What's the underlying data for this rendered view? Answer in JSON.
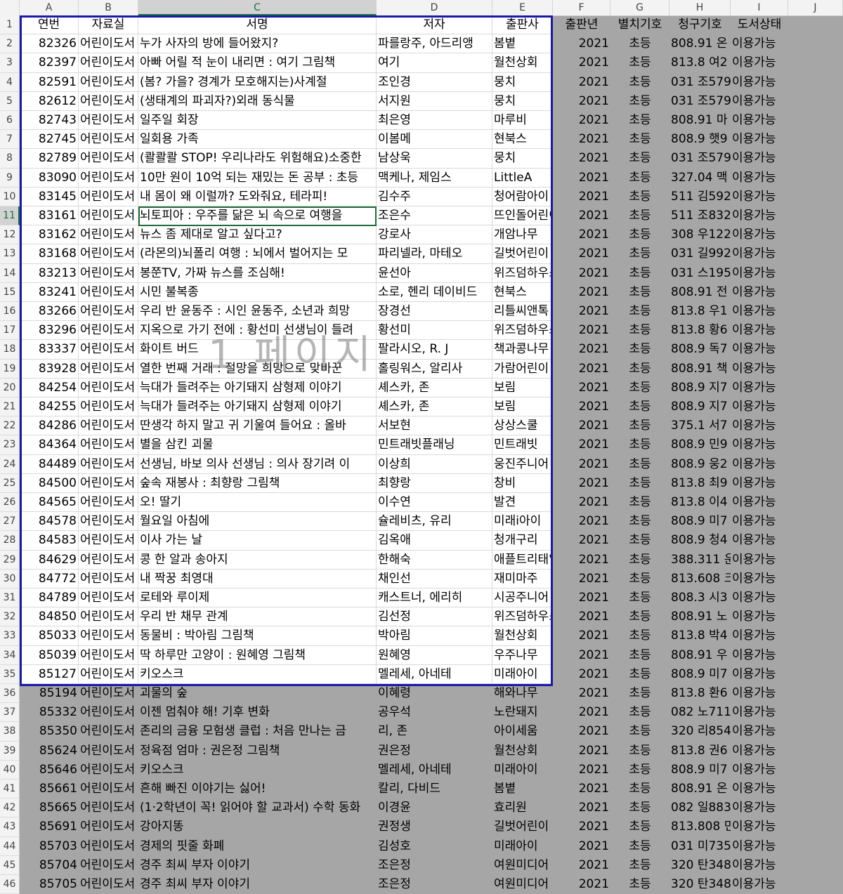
{
  "column_headers": [
    "A",
    "B",
    "C",
    "D",
    "E",
    "F",
    "G",
    "H",
    "I",
    "J"
  ],
  "selected_column": "C",
  "selected_row": 11,
  "watermark": "1 페이지",
  "header_row": [
    "연번",
    "자료실",
    "서명",
    "저자",
    "출판사",
    "출판년",
    "별치기호",
    "청구기호",
    "도서상태"
  ],
  "rows": [
    [
      "82326",
      "어린이도서",
      "누가 사자의 방에 들어왔지?",
      "파를랑주, 아드리앵",
      "봄볕",
      "2021",
      "초등",
      "808.91 온",
      "이용가능"
    ],
    [
      "82397",
      "어린이도서",
      "아빠 어릴 적 눈이 내리면 : 여기 그림책",
      "여기",
      "월천상회",
      "2021",
      "초등",
      "813.8 여2",
      "이용가능"
    ],
    [
      "82591",
      "어린이도서",
      "(봄? 가을? 경계가 모호해지는)사계절",
      "조인경",
      "뭉치",
      "2021",
      "초등",
      "031 조579",
      "이용가능"
    ],
    [
      "82612",
      "어린이도서",
      "(생태계의 파괴자?)외래 동식물",
      "서지원",
      "뭉치",
      "2021",
      "초등",
      "031 조579",
      "이용가능"
    ],
    [
      "82743",
      "어린이도서",
      "일주일 회장",
      "최은영",
      "마루비",
      "2021",
      "초등",
      "808.91 마",
      "이용가능"
    ],
    [
      "82745",
      "어린이도서",
      "일회용 가족",
      "이봄메",
      "현북스",
      "2021",
      "초등",
      "808.9 햇9",
      "이용가능"
    ],
    [
      "82789",
      "어린이도서",
      "(콸콸콸 STOP! 우리나라도 위험해요)소중한",
      "남상욱",
      "뭉치",
      "2021",
      "초등",
      "031 조579",
      "이용가능"
    ],
    [
      "83090",
      "어린이도서",
      "10만 원이 10억 되는 재밌는 돈 공부 : 초등",
      "맥케나, 제임스",
      "LittleA",
      "2021",
      "초등",
      "327.04 맥",
      "이용가능"
    ],
    [
      "83145",
      "어린이도서",
      "내 몸이 왜 이럴까? 도와줘요, 테라피!",
      "김수주",
      "청어람아이",
      "2021",
      "초등",
      "511 김592",
      "이용가능"
    ],
    [
      "83161",
      "어린이도서",
      "뇌토피아 : 우주를 닮은 뇌 속으로 여행을",
      "조은수",
      "뜨인돌어린이",
      "2021",
      "초등",
      "511 조832",
      "이용가능"
    ],
    [
      "83162",
      "어린이도서",
      "뉴스 좀 제대로 알고 싶다고?",
      "강로사",
      "개암나무",
      "2021",
      "초등",
      "308 우122",
      "이용가능"
    ],
    [
      "83168",
      "어린이도서",
      "(라몬의)뇌폴리 여행 : 뇌에서 벌어지는 모",
      "파리넬라, 마테오",
      "길벗어린이",
      "2021",
      "초등",
      "031 길992",
      "이용가능"
    ],
    [
      "83213",
      "어린이도서",
      "봉쭌TV, 가짜 뉴스를 조심해!",
      "윤선아",
      "위즈덤하우스",
      "2021",
      "초등",
      "031 스195",
      "이용가능"
    ],
    [
      "83241",
      "어린이도서",
      "시민 불복종",
      "소로, 헨리 데이비드",
      "현북스",
      "2021",
      "초등",
      "808.91 전",
      "이용가능"
    ],
    [
      "83266",
      "어린이도서",
      "우리 반 윤동주 : 시인 윤동주, 소년과 희망",
      "장경선",
      "리틀씨앤톡",
      "2021",
      "초등",
      "813.8 우1",
      "이용가능"
    ],
    [
      "83296",
      "어린이도서",
      "지옥으로 가기 전에 : 황선미 선생님이 들려",
      "황선미",
      "위즈덤하우스",
      "2021",
      "초등",
      "813.8 황6",
      "이용가능"
    ],
    [
      "83337",
      "어린이도서",
      "화이트 버드",
      "팔라시오, R. J",
      "책과콩나무",
      "2021",
      "초등",
      "808.9 독7",
      "이용가능"
    ],
    [
      "83928",
      "어린이도서",
      "열한 번째 거래 : 절망을 희망으로 맞바꾼",
      "홀링워스, 알리사",
      "가람어린이",
      "2021",
      "초등",
      "808.91 책",
      "이용가능"
    ],
    [
      "84254",
      "어린이도서",
      "늑대가 들려주는 아기돼지 삼형제 이야기",
      "셰스카, 존",
      "보림",
      "2021",
      "초등",
      "808.9 지7",
      "이용가능"
    ],
    [
      "84255",
      "어린이도서",
      "늑대가 들려주는 아기돼지 삼형제 이야기",
      "셰스카, 존",
      "보림",
      "2021",
      "초등",
      "808.9 지7",
      "이용가능"
    ],
    [
      "84286",
      "어린이도서",
      "딴생각 하지 말고 귀 기울여 들어요 : 올바",
      "서보현",
      "상상스쿨",
      "2021",
      "초등",
      "375.1 서7",
      "이용가능"
    ],
    [
      "84364",
      "어린이도서",
      "별을 삼킨 괴물",
      "민트래빗플래닝",
      "민트래빗",
      "2021",
      "초등",
      "808.9 민9",
      "이용가능"
    ],
    [
      "84489",
      "어린이도서",
      "선생님, 바보 의사 선생님 : 의사 장기려 이",
      "이상희",
      "웅진주니어",
      "2021",
      "초등",
      "808.9 웅2",
      "이용가능"
    ],
    [
      "84500",
      "어린이도서",
      "숲속 재봉사 : 최향랑 그림책",
      "최향랑",
      "창비",
      "2021",
      "초등",
      "813.8 최9",
      "이용가능"
    ],
    [
      "84565",
      "어린이도서",
      "오! 딸기",
      "이수연",
      "발견",
      "2021",
      "초등",
      "813.8 이4",
      "이용가능"
    ],
    [
      "84578",
      "어린이도서",
      "월요일 아침에",
      "슐레비츠, 유리",
      "미래i아이",
      "2021",
      "초등",
      "808.9 미7",
      "이용가능"
    ],
    [
      "84583",
      "어린이도서",
      "이사 가는 날",
      "김옥애",
      "청개구리",
      "2021",
      "초등",
      "808.9 청4",
      "이용가능"
    ],
    [
      "84629",
      "어린이도서",
      "콩 한 알과 송아지",
      "한해숙",
      "애플트리태일즈",
      "2021",
      "초등",
      "388.311 운",
      "이용가능"
    ],
    [
      "84772",
      "어린이도서",
      "내 짝꿍 최영대",
      "채인선",
      "재미마주",
      "2021",
      "초등",
      "813.608 크",
      "이용가능"
    ],
    [
      "84789",
      "어린이도서",
      "로테와 루이제",
      "캐스트너, 에리히",
      "시공주니어",
      "2021",
      "초등",
      "808.3 시3",
      "이용가능"
    ],
    [
      "84850",
      "어린이도서",
      "우리 반 채무 관계",
      "김선정",
      "위즈덤하우스",
      "2021",
      "초등",
      "808.91 노",
      "이용가능"
    ],
    [
      "85033",
      "어린이도서",
      "동물비 : 박아림 그림책",
      "박아림",
      "월천상회",
      "2021",
      "초등",
      "813.8 박4",
      "이용가능"
    ],
    [
      "85039",
      "어린이도서",
      "딱 하루만 고양이 : 원혜영 그림책",
      "원혜영",
      "우주나무",
      "2021",
      "초등",
      "808.91 우",
      "이용가능"
    ],
    [
      "85127",
      "어린이도서",
      "키오스크",
      "멜레세, 아네테",
      "미래아이",
      "2021",
      "초등",
      "808.9 미7",
      "이용가능"
    ],
    [
      "85194",
      "어린이도서",
      "괴물의 숲",
      "이혜령",
      "해와나무",
      "2021",
      "초등",
      "813.8 환6",
      "이용가능"
    ],
    [
      "85332",
      "어린이도서",
      "이젠 멈춰야 해! 기후 변화",
      "공우석",
      "노란돼지",
      "2021",
      "초등",
      "082 노711",
      "이용가능"
    ],
    [
      "85350",
      "어린이도서",
      "존리의 금융 모험생 클럽 : 처음 만나는 금",
      "리, 존",
      "아이세움",
      "2021",
      "초등",
      "320 리854",
      "이용가능"
    ],
    [
      "85624",
      "어린이도서",
      "정육점 엄마 : 권은정 그림책",
      "권은정",
      "월천상회",
      "2021",
      "초등",
      "813.8 권6",
      "이용가능"
    ],
    [
      "85646",
      "어린이도서",
      "키오스크",
      "멜레세, 아네테",
      "미래아이",
      "2021",
      "초등",
      "808.9 미7",
      "이용가능"
    ],
    [
      "85661",
      "어린이도서",
      "흔해 빠진 이야기는 싫어!",
      "칼리, 다비드",
      "봄볕",
      "2021",
      "초등",
      "808.91 온",
      "이용가능"
    ],
    [
      "85665",
      "어린이도서",
      "(1·2학년이 꼭! 읽어야 할 교과서) 수학 동화",
      "이경윤",
      "효리원",
      "2021",
      "초등",
      "082 일883",
      "이용가능"
    ],
    [
      "85691",
      "어린이도서",
      "강아지똥",
      "권정생",
      "길벗어린이",
      "2021",
      "초등",
      "813.808 민",
      "이용가능"
    ],
    [
      "85703",
      "어린이도서",
      "경제의 핏줄 화폐",
      "김성호",
      "미래아이",
      "2021",
      "초등",
      "031 미735",
      "이용가능"
    ],
    [
      "85704",
      "어린이도서",
      "경주 최씨 부자 이야기",
      "조은정",
      "여원미디어",
      "2021",
      "초등",
      "320 탄348",
      "이용가능"
    ],
    [
      "85705",
      "어린이도서",
      "경주 최씨 부자 이야기",
      "조은정",
      "여원미디어",
      "2021",
      "초등",
      "320 탄348",
      "이용가능"
    ]
  ]
}
